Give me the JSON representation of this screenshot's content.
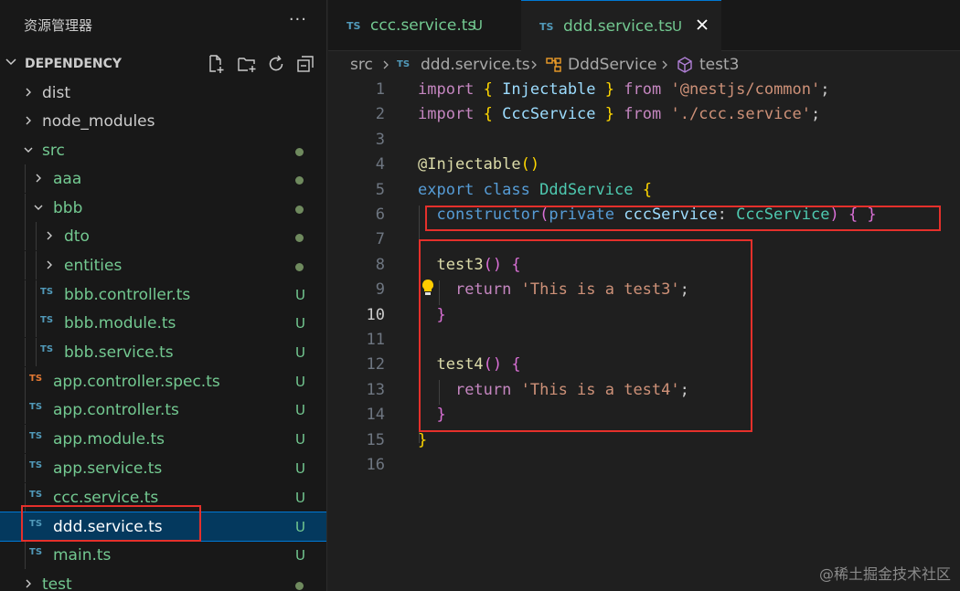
{
  "sidebar": {
    "title": "资源管理器",
    "more_icon": "···",
    "section": "DEPENDENCY",
    "action_icons": [
      "new-file-icon",
      "new-folder-icon",
      "refresh-icon",
      "collapse-all-icon"
    ],
    "tree": [
      {
        "name": "dist",
        "kind": "folder",
        "open": false
      },
      {
        "name": "node_modules",
        "kind": "folder",
        "open": false
      },
      {
        "name": "src",
        "kind": "folder",
        "open": true,
        "status": "dot"
      },
      {
        "name": "aaa",
        "kind": "folder",
        "open": false,
        "status": "dot"
      },
      {
        "name": "bbb",
        "kind": "folder",
        "open": true,
        "status": "dot"
      },
      {
        "name": "dto",
        "kind": "folder",
        "open": false,
        "status": "dot"
      },
      {
        "name": "entities",
        "kind": "folder",
        "open": false,
        "status": "dot"
      },
      {
        "name": "bbb.controller.ts",
        "kind": "ts",
        "icon_text": "TS",
        "status": "U"
      },
      {
        "name": "bbb.module.ts",
        "kind": "ts",
        "icon_text": "TS",
        "status": "U"
      },
      {
        "name": "bbb.service.ts",
        "kind": "ts",
        "icon_text": "TS",
        "status": "U"
      },
      {
        "name": "app.controller.spec.ts",
        "kind": "ts-spec",
        "icon_text": "TS",
        "status": "U"
      },
      {
        "name": "app.controller.ts",
        "kind": "ts",
        "icon_text": "TS",
        "status": "U"
      },
      {
        "name": "app.module.ts",
        "kind": "ts",
        "icon_text": "TS",
        "status": "U"
      },
      {
        "name": "app.service.ts",
        "kind": "ts",
        "icon_text": "TS",
        "status": "U"
      },
      {
        "name": "ccc.service.ts",
        "kind": "ts",
        "icon_text": "TS",
        "status": "U"
      },
      {
        "name": "ddd.service.ts",
        "kind": "ts",
        "icon_text": "TS",
        "status": "U",
        "selected": true
      },
      {
        "name": "main.ts",
        "kind": "ts",
        "icon_text": "TS",
        "status": "U"
      },
      {
        "name": "test",
        "kind": "folder",
        "open": false,
        "status": "dot"
      }
    ]
  },
  "tabs": [
    {
      "icon_text": "TS",
      "name": "ccc.service.ts",
      "badge": "U",
      "active": false
    },
    {
      "icon_text": "TS",
      "name": "ddd.service.ts",
      "badge": "U",
      "active": true,
      "close_icon": "close-icon"
    }
  ],
  "breadcrumb": {
    "folder": "src",
    "file_icon_text": "TS",
    "file": "ddd.service.ts",
    "class_icon": "class-icon",
    "class": "DddService",
    "method_icon": "method-cube-icon",
    "method": "test3"
  },
  "editor": {
    "current_line": 10,
    "line_numbers": [
      "1",
      "2",
      "3",
      "4",
      "5",
      "6",
      "7",
      "8",
      "9",
      "10",
      "11",
      "12",
      "13",
      "14",
      "15",
      "16"
    ],
    "lines": [
      [
        [
          "kw",
          "import"
        ],
        [
          "pl",
          " "
        ],
        [
          "br1",
          "{"
        ],
        [
          "pl",
          " "
        ],
        [
          "var",
          "Injectable"
        ],
        [
          "pl",
          " "
        ],
        [
          "br1",
          "}"
        ],
        [
          "pl",
          " "
        ],
        [
          "kw",
          "from"
        ],
        [
          "pl",
          " "
        ],
        [
          "str",
          "'@nestjs/common'"
        ],
        [
          "pl",
          ";"
        ]
      ],
      [
        [
          "kw",
          "import"
        ],
        [
          "pl",
          " "
        ],
        [
          "br1",
          "{"
        ],
        [
          "pl",
          " "
        ],
        [
          "var",
          "CccService"
        ],
        [
          "pl",
          " "
        ],
        [
          "br1",
          "}"
        ],
        [
          "pl",
          " "
        ],
        [
          "kw",
          "from"
        ],
        [
          "pl",
          " "
        ],
        [
          "str",
          "'./ccc.service'"
        ],
        [
          "pl",
          ";"
        ]
      ],
      [],
      [
        [
          "fn",
          "@Injectable"
        ],
        [
          "br1",
          "()"
        ]
      ],
      [
        [
          "blue",
          "export"
        ],
        [
          "pl",
          " "
        ],
        [
          "blue",
          "class"
        ],
        [
          "pl",
          " "
        ],
        [
          "cls",
          "DddService"
        ],
        [
          "pl",
          " "
        ],
        [
          "br1",
          "{"
        ]
      ],
      [
        [
          "pl",
          "  "
        ],
        [
          "blue",
          "constructor"
        ],
        [
          "br2",
          "("
        ],
        [
          "blue",
          "private"
        ],
        [
          "pl",
          " "
        ],
        [
          "var",
          "cccService"
        ],
        [
          "pl",
          ": "
        ],
        [
          "cls",
          "CccService"
        ],
        [
          "br2",
          ")"
        ],
        [
          "pl",
          " "
        ],
        [
          "br2",
          "{ }"
        ]
      ],
      [],
      [
        [
          "pl",
          "  "
        ],
        [
          "fn",
          "test3"
        ],
        [
          "br2",
          "()"
        ],
        [
          "pl",
          " "
        ],
        [
          "br2",
          "{"
        ]
      ],
      [
        [
          "pl",
          "    "
        ],
        [
          "kw",
          "return"
        ],
        [
          "pl",
          " "
        ],
        [
          "str",
          "'This is a test3'"
        ],
        [
          "pl",
          ";"
        ]
      ],
      [
        [
          "pl",
          "  "
        ],
        [
          "br2",
          "}"
        ]
      ],
      [],
      [
        [
          "pl",
          "  "
        ],
        [
          "fn",
          "test4"
        ],
        [
          "br2",
          "()"
        ],
        [
          "pl",
          " "
        ],
        [
          "br2",
          "{"
        ]
      ],
      [
        [
          "pl",
          "    "
        ],
        [
          "kw",
          "return"
        ],
        [
          "pl",
          " "
        ],
        [
          "str",
          "'This is a test4'"
        ],
        [
          "pl",
          ";"
        ]
      ],
      [
        [
          "pl",
          "  "
        ],
        [
          "br2",
          "}"
        ]
      ],
      [
        [
          "br1",
          "}"
        ]
      ],
      []
    ]
  },
  "watermark": "@稀土掘金技术社区",
  "colors": {
    "accent": "#0078d4",
    "highlight_box": "#e5302b",
    "untracked": "#73c991",
    "ts_icon": "#519aba"
  }
}
